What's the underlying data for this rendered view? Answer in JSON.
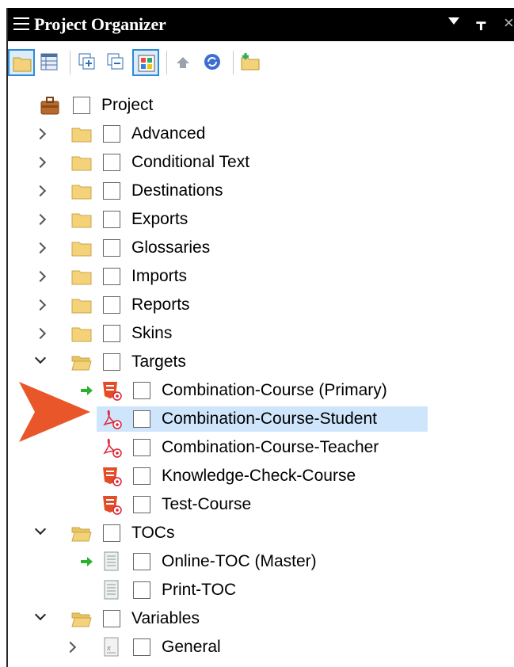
{
  "panel": {
    "title": "Project Organizer",
    "close_glyph": "×",
    "pin_glyph": "ᚁ"
  },
  "toolbar": {
    "buttons": [
      {
        "name": "open-folder-button",
        "icon": "folder-open-icon",
        "selected": true
      },
      {
        "name": "view-table-button",
        "icon": "table-icon",
        "selected": false
      },
      {
        "name": "expand-all-button",
        "icon": "expand-all-icon",
        "selected": false
      },
      {
        "name": "collapse-all-button",
        "icon": "collapse-all-icon",
        "selected": false
      },
      {
        "name": "show-all-button",
        "icon": "grid-color-icon",
        "selected": true
      },
      {
        "name": "bind-button",
        "icon": "bind-icon",
        "selected": false
      },
      {
        "name": "refresh-button",
        "icon": "refresh-icon",
        "selected": false
      },
      {
        "name": "new-folder-button",
        "icon": "new-folder-icon",
        "selected": false
      }
    ]
  },
  "tree": {
    "root": {
      "label": "Project",
      "icon": "briefcase-icon"
    },
    "folders": [
      {
        "label": "Advanced",
        "expanded": false
      },
      {
        "label": "Conditional Text",
        "expanded": false
      },
      {
        "label": "Destinations",
        "expanded": false
      },
      {
        "label": "Exports",
        "expanded": false
      },
      {
        "label": "Glossaries",
        "expanded": false
      },
      {
        "label": "Imports",
        "expanded": false
      },
      {
        "label": "Reports",
        "expanded": false
      },
      {
        "label": "Skins",
        "expanded": false
      },
      {
        "label": "Targets",
        "expanded": true
      },
      {
        "label": "TOCs",
        "expanded": true
      },
      {
        "label": "Variables",
        "expanded": true
      }
    ],
    "targets": [
      {
        "label": "Combination-Course (Primary)",
        "icon": "html5-target-icon",
        "primary": true
      },
      {
        "label": "Combination-Course-Student",
        "icon": "pdf-target-icon",
        "primary": false,
        "highlighted": true
      },
      {
        "label": "Combination-Course-Teacher",
        "icon": "pdf-target-icon",
        "primary": false
      },
      {
        "label": "Knowledge-Check-Course",
        "icon": "html5-target-icon",
        "primary": false
      },
      {
        "label": "Test-Course",
        "icon": "html5-target-icon",
        "primary": false
      }
    ],
    "tocs": [
      {
        "label": "Online-TOC (Master)",
        "icon": "toc-icon",
        "primary": true
      },
      {
        "label": "Print-TOC",
        "icon": "toc-icon",
        "primary": false
      }
    ],
    "variables": [
      {
        "label": "General",
        "icon": "variable-file-icon"
      }
    ]
  },
  "colors": {
    "highlight": "#cfe5fb",
    "pointer": "#e8562a",
    "folder": "#f3d27a",
    "accent": "#2e8ad8",
    "primary_arrow": "#2cb12c"
  }
}
